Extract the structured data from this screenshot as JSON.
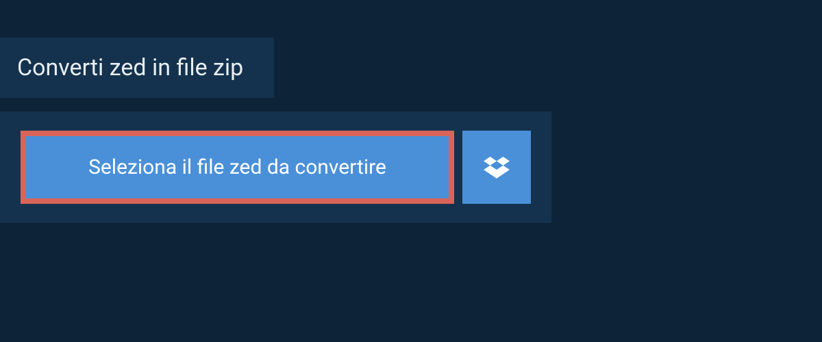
{
  "tab": {
    "title": "Converti zed in file zip"
  },
  "upload": {
    "select_button_label": "Seleziona il file zed da convertire"
  },
  "colors": {
    "background": "#0d2438",
    "panel": "#14324d",
    "button": "#4a90d9",
    "highlight_border": "#d96459",
    "text_light": "#e8eef3",
    "text_white": "#ffffff"
  }
}
